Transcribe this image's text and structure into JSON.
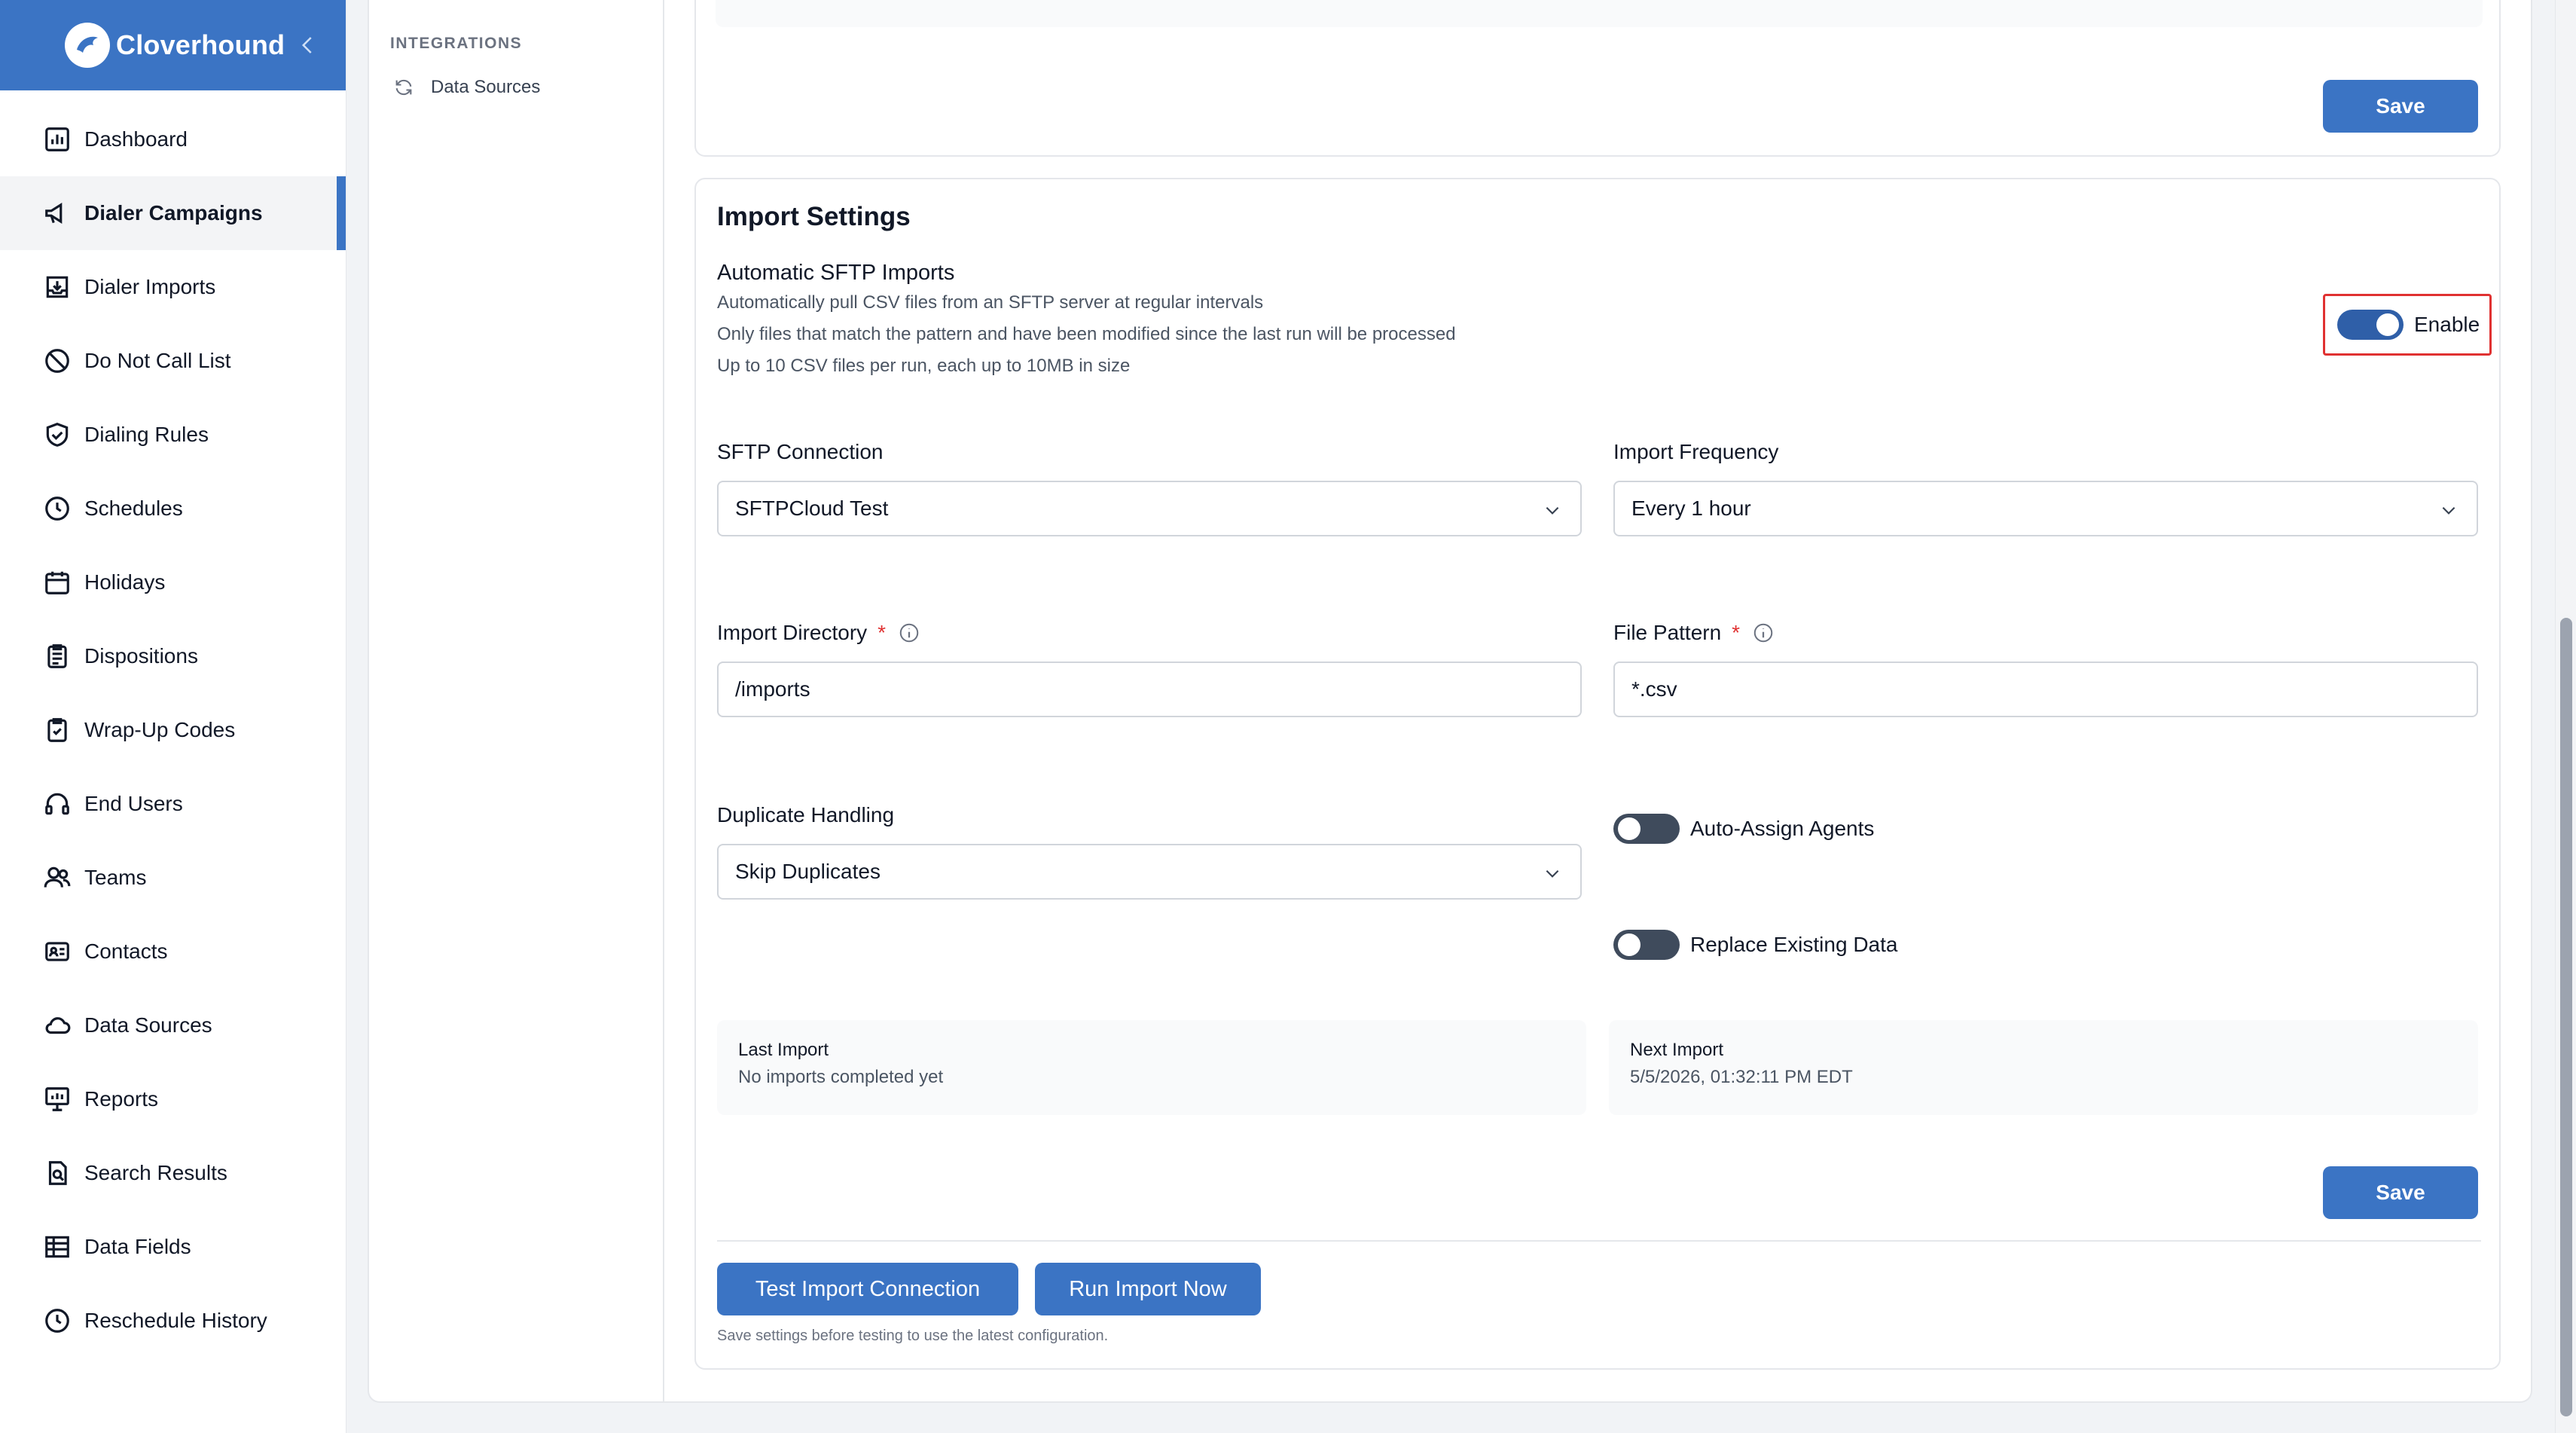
{
  "app": {
    "brand": "Cloverhound",
    "accent_color": "#3b74c4"
  },
  "sidebar": {
    "items": [
      {
        "label": "Dashboard",
        "icon": "chart-bar-icon"
      },
      {
        "label": "Dialer Campaigns",
        "icon": "megaphone-icon",
        "active": true
      },
      {
        "label": "Dialer Imports",
        "icon": "tray-download-icon"
      },
      {
        "label": "Do Not Call List",
        "icon": "prohibited-icon"
      },
      {
        "label": "Dialing Rules",
        "icon": "shield-check-icon"
      },
      {
        "label": "Schedules",
        "icon": "clock-icon"
      },
      {
        "label": "Holidays",
        "icon": "calendar-icon"
      },
      {
        "label": "Dispositions",
        "icon": "clipboard-list-icon"
      },
      {
        "label": "Wrap-Up Codes",
        "icon": "clipboard-check-icon"
      },
      {
        "label": "End Users",
        "icon": "headset-icon"
      },
      {
        "label": "Teams",
        "icon": "users-icon"
      },
      {
        "label": "Contacts",
        "icon": "contact-card-icon"
      },
      {
        "label": "Data Sources",
        "icon": "cloud-icon"
      },
      {
        "label": "Reports",
        "icon": "presentation-chart-icon"
      },
      {
        "label": "Search Results",
        "icon": "document-search-icon"
      },
      {
        "label": "Data Fields",
        "icon": "table-icon"
      },
      {
        "label": "Reschedule History",
        "icon": "clock-icon"
      }
    ]
  },
  "subnav": {
    "heading": "INTEGRATIONS",
    "item": "Data Sources"
  },
  "top_card": {
    "save_label": "Save"
  },
  "import_settings": {
    "title": "Import Settings",
    "section_title": "Automatic SFTP Imports",
    "descriptions": [
      "Automatically pull CSV files from an SFTP server at regular intervals",
      "Only files that match the pattern and have been modified since the last run will be processed",
      "Up to 10 CSV files per run, each up to 10MB in size"
    ],
    "enable_label": "Enable",
    "enabled": true,
    "sftp_connection": {
      "label": "SFTP Connection",
      "value": "SFTPCloud Test"
    },
    "import_frequency": {
      "label": "Import Frequency",
      "value": "Every 1 hour"
    },
    "import_directory": {
      "label": "Import Directory",
      "required": "*",
      "value": "/imports"
    },
    "file_pattern": {
      "label": "File Pattern",
      "required": "*",
      "value": "*.csv"
    },
    "duplicate_handling": {
      "label": "Duplicate Handling",
      "value": "Skip Duplicates"
    },
    "auto_assign": {
      "label": "Auto-Assign Agents",
      "enabled": false
    },
    "replace_existing": {
      "label": "Replace Existing Data",
      "enabled": false
    },
    "last_import": {
      "label": "Last Import",
      "value": "No imports completed yet"
    },
    "next_import": {
      "label": "Next Import",
      "value": "5/5/2026, 01:32:11 PM EDT"
    },
    "save_label": "Save",
    "test_button": "Test Import Connection",
    "run_button": "Run Import Now",
    "hint": "Save settings before testing to use the latest configuration."
  }
}
